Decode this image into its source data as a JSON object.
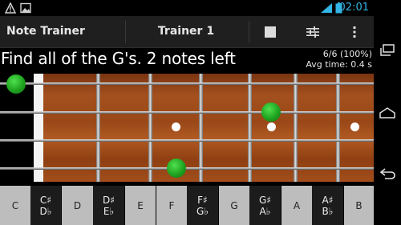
{
  "status_bar": {
    "time": "02:01",
    "icons": [
      "warning-icon",
      "image-icon",
      "signal-icon",
      "battery-icon"
    ]
  },
  "action_bar": {
    "app_title": "Note Trainer",
    "trainer_title": "Trainer 1",
    "actions": [
      "stop-icon",
      "settings-sliders-icon",
      "overflow-menu-icon"
    ]
  },
  "prompt": {
    "text": "Find all of the G's. 2 notes left",
    "score_line": "6/6 (100%)",
    "avg_time_line": "Avg time: 0.4 s"
  },
  "fretboard": {
    "strings": 4,
    "frets_visible": 7,
    "note_markers": [
      {
        "string": 1,
        "fret": 0
      },
      {
        "string": 2,
        "fret": 5
      },
      {
        "string": 4,
        "fret": 3
      }
    ],
    "inlay_frets": [
      3,
      5,
      7
    ]
  },
  "keyboard": {
    "keys": [
      {
        "label": "C",
        "type": "white"
      },
      {
        "label": "C♯\nD♭",
        "type": "black"
      },
      {
        "label": "D",
        "type": "white"
      },
      {
        "label": "D♯\nE♭",
        "type": "black"
      },
      {
        "label": "E",
        "type": "white"
      },
      {
        "label": "F",
        "type": "white"
      },
      {
        "label": "F♯\nG♭",
        "type": "black"
      },
      {
        "label": "G",
        "type": "white"
      },
      {
        "label": "G♯\nA♭",
        "type": "black"
      },
      {
        "label": "A",
        "type": "white"
      },
      {
        "label": "A♯\nB♭",
        "type": "black"
      },
      {
        "label": "B",
        "type": "white"
      }
    ]
  },
  "nav_bar": {
    "buttons": [
      "recent-apps-icon",
      "home-icon",
      "back-icon"
    ]
  },
  "colors": {
    "accent": "#33b5e5",
    "note_marker": "#22aa22",
    "white_key": "#bdbdbd",
    "black_key": "#1c1c1c"
  }
}
